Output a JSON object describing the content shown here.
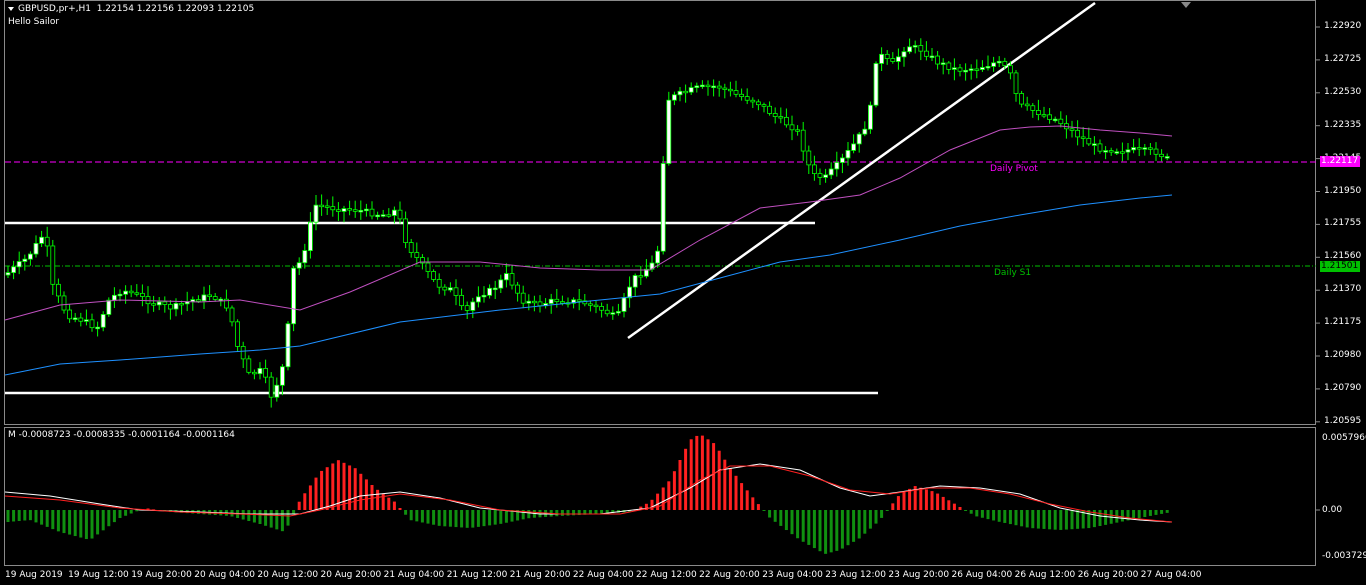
{
  "chart_header": {
    "symbol_timeframe": "GBPUSD,pr+,H1",
    "ohlc": "1.22154 1.22156 1.22093 1.22105",
    "ea_name": "Hello Sailor"
  },
  "indicator_header": {
    "label": "M -0.0008723 -0.0008335 -0.0001164 -0.0001164"
  },
  "price_axis": {
    "ticks": [
      "1.22920",
      "1.22725",
      "1.22530",
      "1.22335",
      "1.22145",
      "1.21950",
      "1.21755",
      "1.21560",
      "1.21370",
      "1.21175",
      "1.20980",
      "1.20790",
      "1.20595"
    ],
    "current_price": "1.22117",
    "s1_price": "1.21501"
  },
  "indicator_axis": {
    "ticks": [
      "0.0057966",
      "0.00",
      "-0.003729"
    ]
  },
  "time_axis": {
    "labels": [
      "19 Aug 2019",
      "19 Aug 12:00",
      "19 Aug 20:00",
      "20 Aug 04:00",
      "20 Aug 12:00",
      "20 Aug 20:00",
      "21 Aug 04:00",
      "21 Aug 12:00",
      "21 Aug 20:00",
      "22 Aug 04:00",
      "22 Aug 12:00",
      "22 Aug 20:00",
      "23 Aug 04:00",
      "23 Aug 12:00",
      "23 Aug 20:00",
      "26 Aug 04:00",
      "26 Aug 12:00",
      "26 Aug 20:00",
      "27 Aug 04:00"
    ]
  },
  "levels": {
    "pivot_label": "Daily Pivot",
    "s1_label": "Daily S1"
  },
  "colors": {
    "background": "#000000",
    "bull_candle": "#ffffff",
    "bear_candle": "#000000",
    "wick": "#00ff00",
    "pivot": "#ff00ff",
    "s1": "#00c000",
    "ma_fast": "#c050c0",
    "ma_slow": "#1e90ff",
    "hist_pos": "#ff2020",
    "hist_neg": "#109010",
    "osc_main": "#ffffff",
    "osc_signal": "#ff2020"
  }
}
